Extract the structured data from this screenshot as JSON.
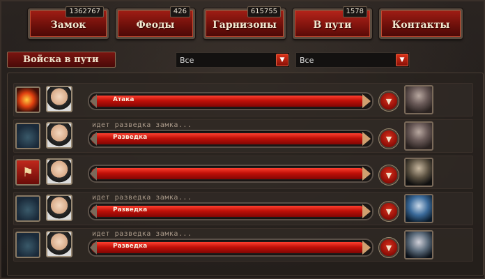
{
  "tabs": [
    {
      "label": "Замок",
      "count": "1362767",
      "active": false
    },
    {
      "label": "Феоды",
      "count": "426",
      "active": false
    },
    {
      "label": "Гарнизоны",
      "count": "615755",
      "active": false
    },
    {
      "label": "В пути",
      "count": "1578",
      "active": true
    },
    {
      "label": "Контакты",
      "count": "",
      "active": false
    }
  ],
  "section_title": "Войска в пути",
  "filters": [
    {
      "value": "Все",
      "button_icon": "triangle-down-icon"
    },
    {
      "value": "Все",
      "button_icon": "triangle-down-icon"
    }
  ],
  "rows": [
    {
      "type_icon": "fireball-icon",
      "status": "",
      "bar_label": "Атака",
      "progress": 1.0
    },
    {
      "type_icon": "hooded-scout-icon",
      "status": "идет разведка замка...",
      "bar_label": "Разведка",
      "progress": 1.0
    },
    {
      "type_icon": "banner-icon",
      "status": "",
      "bar_label": "",
      "progress": 1.0
    },
    {
      "type_icon": "hooded-scout-icon",
      "status": "идет разведка замка...",
      "bar_label": "Разведка",
      "progress": 1.0
    },
    {
      "type_icon": "hooded-scout-icon",
      "status": "идет разведка замка...",
      "bar_label": "Разведка",
      "progress": 1.0
    }
  ],
  "colors": {
    "accent_red": "#c01008",
    "frame": "#5a4c40"
  }
}
